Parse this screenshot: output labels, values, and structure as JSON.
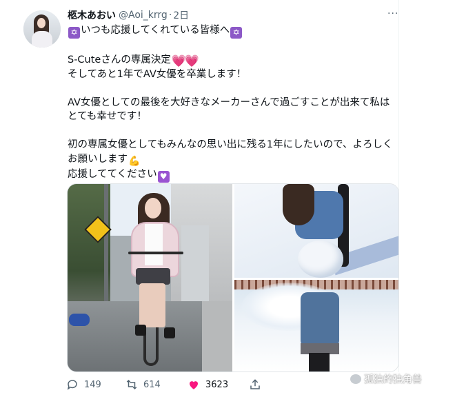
{
  "author": {
    "name": "柩木あおい",
    "handle": "@Aoi_krrg",
    "separator": "·",
    "time": "2日"
  },
  "more_label": "···",
  "tweet": {
    "line1": "いつも応援してくれている皆様へ",
    "line2": "S-Cuteさんの専属決定",
    "line3": "そしてあと1年でAV女優を卒業します！",
    "line4": "AV女優としての最後を大好きなメーカーさんで過ごすことが出来て私はとても幸せです！",
    "line5": "初の専属女優としてもみんなの思い出に残る1年にしたいので、よろしくお願いします",
    "line6": "応援しててください",
    "emoji": {
      "star": "✡",
      "heart": "💗",
      "arm": "💪",
      "purple_heart": "♥"
    }
  },
  "actions": {
    "reply_count": "149",
    "retweet_count": "614",
    "like_count": "3623"
  },
  "watermark": "孤独的独角兽",
  "colors": {
    "text": "#0f1419",
    "muted": "#536471",
    "like": "#f91880"
  }
}
